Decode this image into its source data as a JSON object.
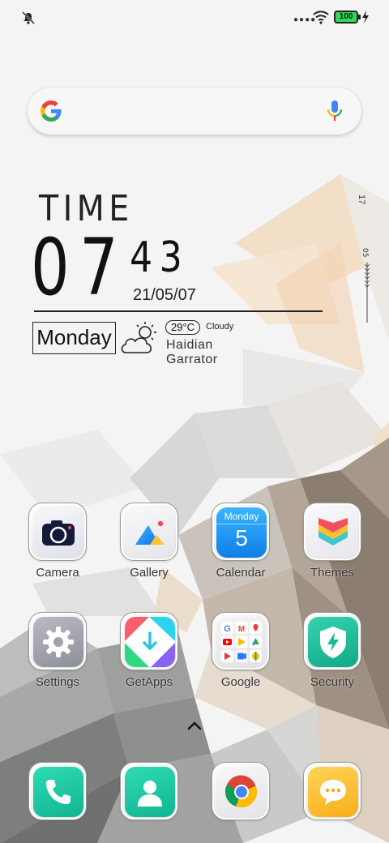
{
  "status_bar": {
    "battery_level": "100",
    "icons": [
      "mute-icon",
      "signal-dots-icon",
      "wifi-icon",
      "battery-icon",
      "charging-bolt-icon"
    ]
  },
  "search": {
    "icons": [
      "google-logo-icon",
      "microphone-icon"
    ]
  },
  "clock_widget": {
    "label": "TIME",
    "hour": "07",
    "minute": "43",
    "date": "21/05/07",
    "day": "Monday",
    "temperature": "29°C",
    "condition": "Cloudy",
    "location": "Haidian  Garrator",
    "side_number": "17",
    "weather_icon": "partly-cloudy-icon"
  },
  "home_apps": [
    {
      "label": "Camera",
      "icon": "camera-icon"
    },
    {
      "label": "Gallery",
      "icon": "gallery-icon"
    },
    {
      "label": "Calendar",
      "icon": "calendar-icon",
      "day": "Monday",
      "date": "5"
    },
    {
      "label": "Themes",
      "icon": "themes-icon"
    },
    {
      "label": "Settings",
      "icon": "settings-gear-icon"
    },
    {
      "label": "GetApps",
      "icon": "getapps-icon"
    },
    {
      "label": "Google",
      "icon": "google-folder-icon"
    },
    {
      "label": "Security",
      "icon": "security-shield-icon"
    }
  ],
  "dock": [
    {
      "icon": "phone-icon"
    },
    {
      "icon": "contacts-icon"
    },
    {
      "icon": "chrome-icon"
    },
    {
      "icon": "messages-icon"
    }
  ],
  "drawer_handle": {
    "icon": "chevron-up-icon"
  },
  "colors": {
    "battery": "#2fd95a",
    "accent_green": "#1fc29b",
    "calendar_blue": "#1e9bf0",
    "messages_yellow": "#fbbd2d"
  }
}
